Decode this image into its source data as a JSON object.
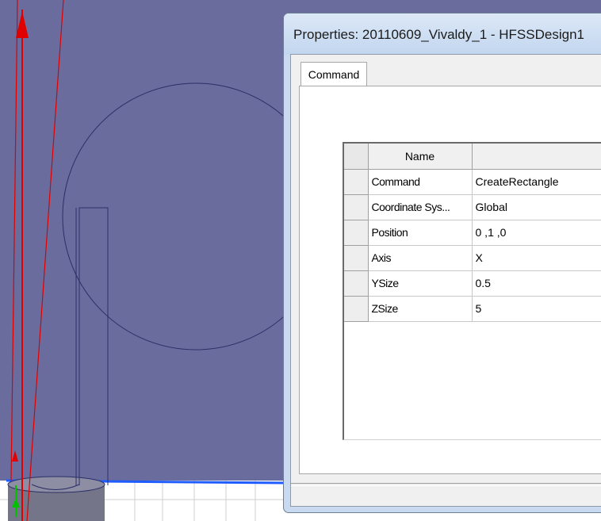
{
  "dialog": {
    "title": "Properties: 20110609_Vivaldy_1 - HFSSDesign1",
    "tab_label": "Command"
  },
  "grid": {
    "header": {
      "name": "Name",
      "value": ""
    },
    "rows": [
      {
        "name": "Command",
        "value": "CreateRectangle"
      },
      {
        "name": "Coordinate Sys...",
        "value": "Global"
      },
      {
        "name": "Position",
        "value": "0 ,1 ,0"
      },
      {
        "name": "Axis",
        "value": "X"
      },
      {
        "name": "YSize",
        "value": "0.5"
      },
      {
        "name": "ZSize",
        "value": "5"
      }
    ]
  },
  "viewport": {
    "colors": {
      "background": "#696c9d",
      "x_axis": "#e00000",
      "z_axis": "#1f5cff",
      "y_axis": "#00c000",
      "outline": "#2b2f66",
      "floor": "#ffffff"
    }
  }
}
